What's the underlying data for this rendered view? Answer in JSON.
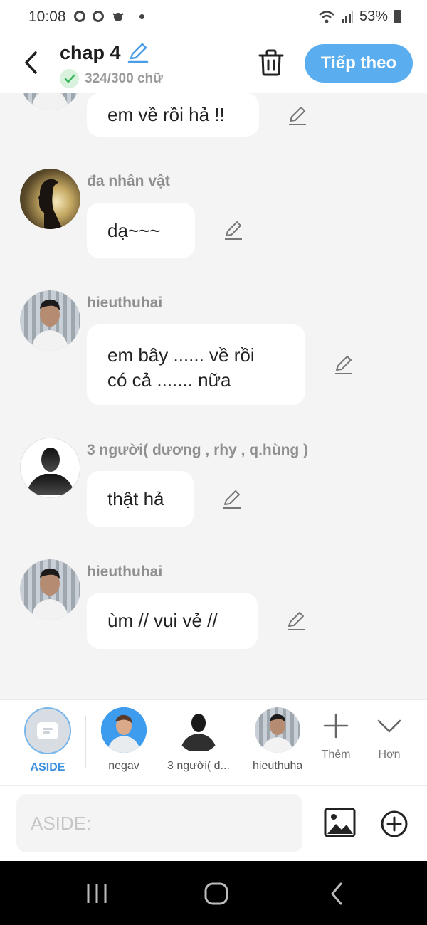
{
  "status_bar": {
    "time": "10:08",
    "battery": "53%"
  },
  "header": {
    "title": "chap 4",
    "word_count": "324/300 chữ",
    "next_button": "Tiếp theo"
  },
  "messages": [
    {
      "speaker": "",
      "avatar": "man-portrait",
      "text": "em về rồi hả !!"
    },
    {
      "speaker": "đa nhân vật",
      "avatar": "silhouette-light",
      "text": "dạ~~~"
    },
    {
      "speaker": "hieuthuhai",
      "avatar": "man-portrait",
      "text_lines": [
        "em bây ...... về rồi",
        "có cả ....... nữa"
      ]
    },
    {
      "speaker": "3 người( dương , rhy , q.hùng )",
      "avatar": "person-silhouette",
      "text": "thật hả"
    },
    {
      "speaker": "hieuthuhai",
      "avatar": "man-portrait",
      "text": "ùm // vui vẻ //"
    }
  ],
  "characters": [
    {
      "label": "ASIDE",
      "active": true
    },
    {
      "label": "negav",
      "active": false
    },
    {
      "label": "3 người( d...",
      "active": false
    },
    {
      "label": "hieuthuhai",
      "active": false
    }
  ],
  "actions": {
    "add_label": "Thêm",
    "more_label": "Hơn"
  },
  "input": {
    "placeholder": "ASIDE:"
  },
  "colors": {
    "accent": "#5aaef0",
    "active_label": "#3a8fdf",
    "check_bg": "#d8f2de",
    "check_mark": "#3cb65e"
  }
}
